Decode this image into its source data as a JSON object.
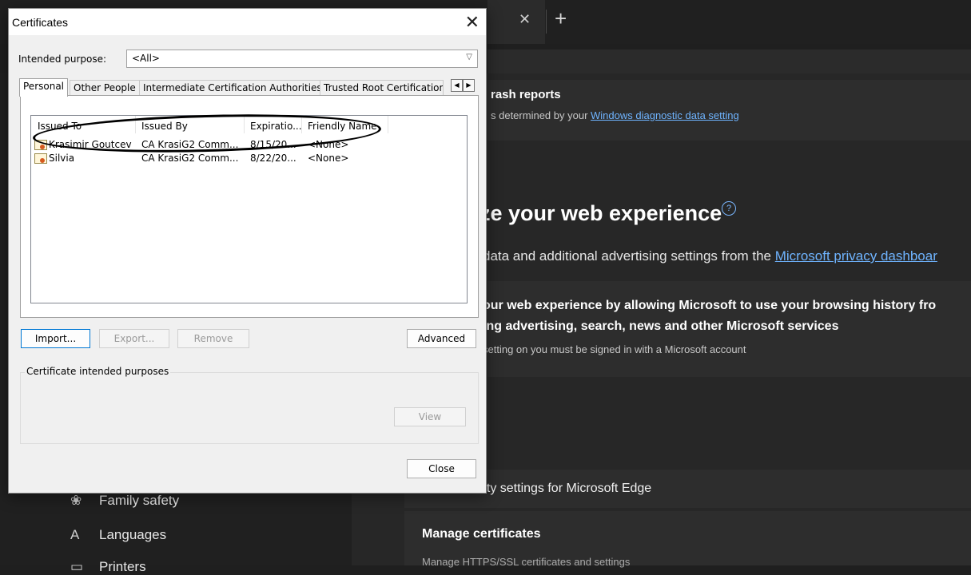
{
  "dialog": {
    "title": "Certificates",
    "close_glyph": "✕",
    "purpose_label": "Intended purpose:",
    "purpose_value": "<All>",
    "tabs": [
      {
        "label": "Personal"
      },
      {
        "label": "Other People"
      },
      {
        "label": "Intermediate Certification Authorities"
      },
      {
        "label": "Trusted Root Certification"
      }
    ],
    "columns": [
      "Issued To",
      "Issued By",
      "Expiratio...",
      "Friendly Name"
    ],
    "rows": [
      {
        "issued_to": "Krasimir Goutcev",
        "issued_by": "CA KrasiG2 Comm...",
        "expiration": "8/15/20...",
        "friendly": "<None>"
      },
      {
        "issued_to": "Silvia",
        "issued_by": "CA KrasiG2 Comm...",
        "expiration": "8/22/20...",
        "friendly": "<None>"
      }
    ],
    "buttons": {
      "import": "Import...",
      "export": "Export...",
      "remove": "Remove",
      "advanced": "Advanced",
      "view": "View",
      "close": "Close"
    },
    "group_label": "Certificate intended purposes"
  },
  "edge": {
    "tab_close": "✕",
    "new_tab": "+",
    "crash_title": "rash reports",
    "crash_sub_prefix": "s determined by your ",
    "crash_link": "Windows diagnostic data setting",
    "personalize_title": "ze your web experience",
    "dashboard_prefix": " data and additional advertising settings from the ",
    "dashboard_link": "Microsoft privacy dashboar",
    "improve_line1": "our web experience by allowing Microsoft to use your browsing history fro",
    "improve_line2": "ing advertising, search, news and other Microsoft services",
    "improve_sub": "setting on you must be signed in with a Microsoft account",
    "security_text": "rity settings for Microsoft Edge",
    "manage_title": "Manage certificates",
    "manage_sub": "Manage HTTPS/SSL certificates and settings",
    "sidebar": [
      {
        "label": "Family safety",
        "icon": "family-icon"
      },
      {
        "label": "Languages",
        "icon": "languages-icon"
      },
      {
        "label": "Printers",
        "icon": "printer-icon"
      }
    ]
  }
}
